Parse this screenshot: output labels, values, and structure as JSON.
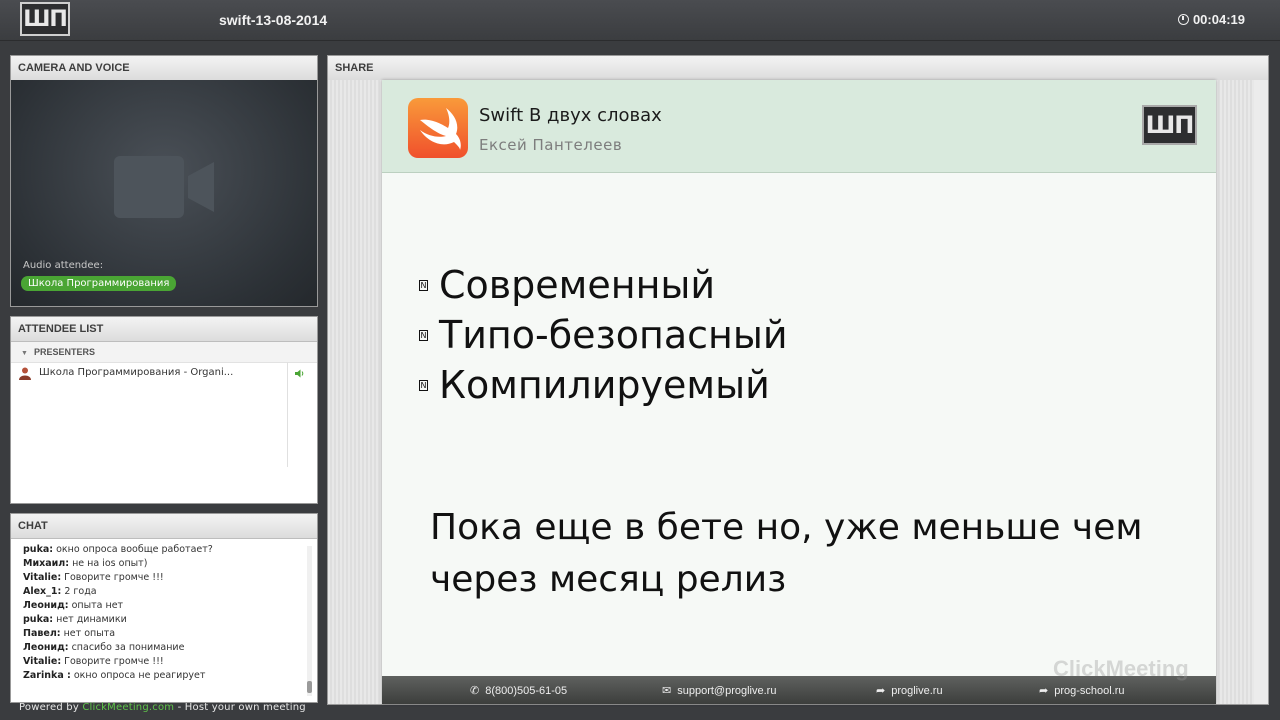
{
  "app": {
    "logo_text": "ШП",
    "meeting_title": "swift-13-08-2014",
    "timer": "00:04:19"
  },
  "camera": {
    "header": "CAMERA AND VOICE",
    "audio_label": "Audio attendee:",
    "audio_name": "Школа Программирования"
  },
  "attendees": {
    "header": "ATTENDEE LIST",
    "section": "PRESENTERS",
    "items": [
      {
        "name": "Школа Программирования - Organi..."
      }
    ]
  },
  "chat": {
    "header": "CHAT",
    "messages": [
      {
        "author": "puka:",
        "text": " окно опроса вообще работает?"
      },
      {
        "author": "Михаил:",
        "text": " не на ios опыт)"
      },
      {
        "author": "Vitalie:",
        "text": " Говорите громче !!!"
      },
      {
        "author": "Alex_1:",
        "text": " 2 года"
      },
      {
        "author": "Леонид:",
        "text": " опыта нет"
      },
      {
        "author": "puka:",
        "text": " нет динамики"
      },
      {
        "author": "Павел:",
        "text": " нет опыта"
      },
      {
        "author": "Леонид:",
        "text": " спасибо за понимание"
      },
      {
        "author": "Vitalie:",
        "text": " Говорите громче !!!"
      },
      {
        "author": "Zarinka :",
        "text": " окно опроса не реагирует"
      }
    ]
  },
  "footer": {
    "powered": "Powered by ",
    "brand": "ClickMeeting.com",
    "tail": " - Host your own meeting"
  },
  "share": {
    "header": "SHARE",
    "slide": {
      "title": "Swift В двух словах",
      "author": "Ексей Пантелеев",
      "logo_text": "ШП",
      "bullets": [
        "Современный",
        "Типо-безопасный",
        "Компилируемый"
      ],
      "note": "Пока еще в бете но, уже меньше чем через месяц релиз",
      "footer": {
        "phone": "8(800)505-61-05",
        "email": "support@proglive.ru",
        "site1": "proglive.ru",
        "site2": "prog-school.ru"
      }
    },
    "watermark": "ClickMeeting"
  },
  "colors": {
    "accent_green": "#4aa534",
    "swift_orange": "#f0502c"
  }
}
